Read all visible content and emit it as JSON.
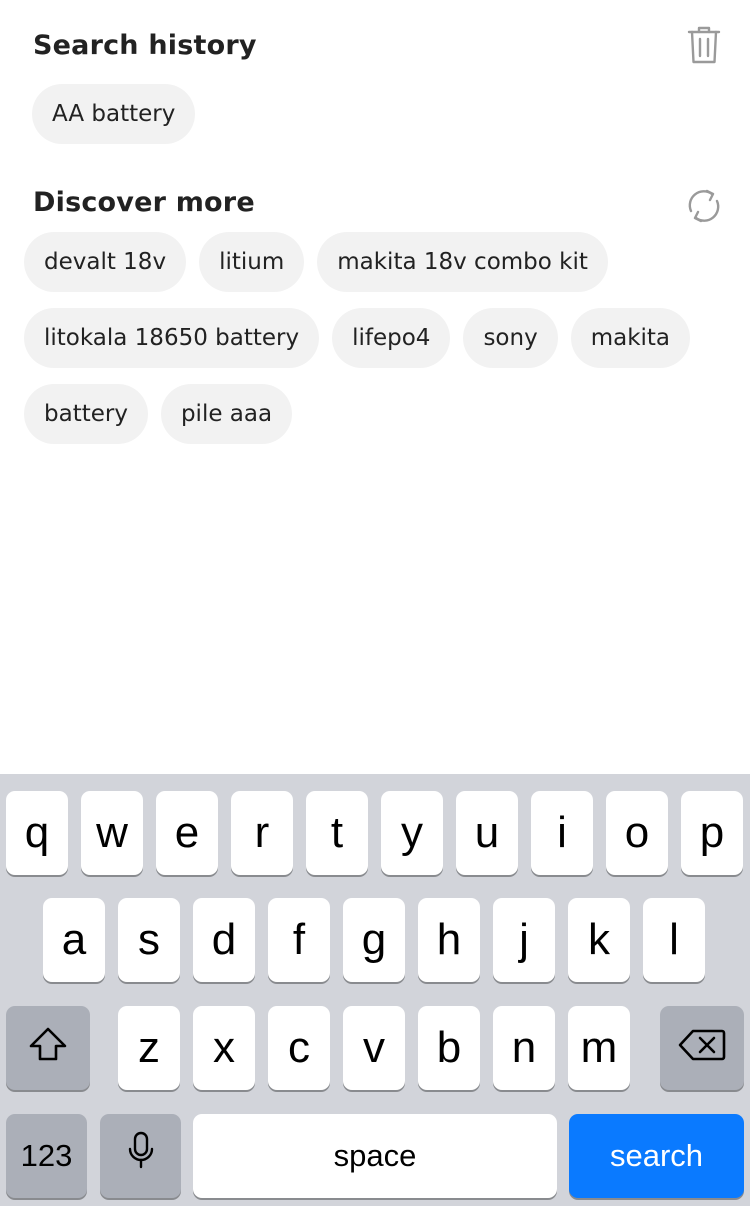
{
  "search_history": {
    "title": "Search history",
    "clear_icon": "trash-icon",
    "items": [
      "AA battery"
    ]
  },
  "discover_more": {
    "title": "Discover more",
    "refresh_icon": "refresh-icon",
    "items": [
      "devalt 18v",
      "litium",
      "makita 18v combo kit",
      "litokala 18650 battery",
      "lifepo4",
      "sony",
      "makita",
      "battery",
      "pile aaa"
    ]
  },
  "keyboard": {
    "row1": [
      "q",
      "w",
      "e",
      "r",
      "t",
      "y",
      "u",
      "i",
      "o",
      "p"
    ],
    "row2": [
      "a",
      "s",
      "d",
      "f",
      "g",
      "h",
      "j",
      "k",
      "l"
    ],
    "row3": [
      "z",
      "x",
      "c",
      "v",
      "b",
      "n",
      "m"
    ],
    "shift_icon": "shift-icon",
    "backspace_icon": "backspace-icon",
    "numbers_label": "123",
    "mic_icon": "microphone-icon",
    "space_label": "space",
    "search_label": "search",
    "search_color": "#0a7aff"
  }
}
